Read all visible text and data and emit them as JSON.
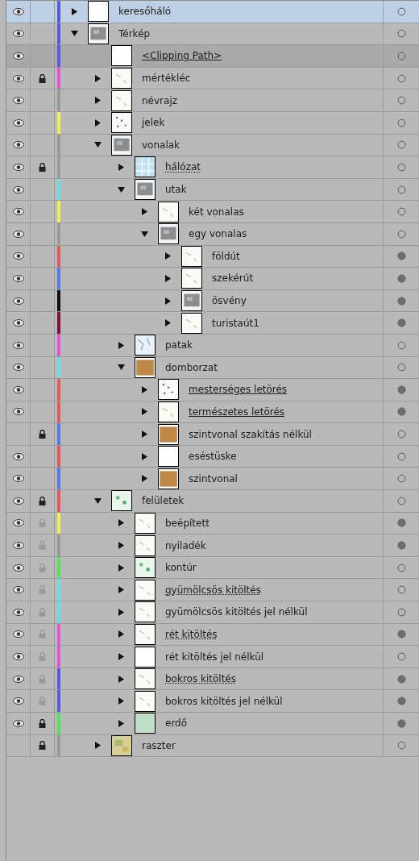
{
  "layers": [
    {
      "kind": "layer",
      "name": "keresőháló",
      "selected": true,
      "visible": true,
      "locked": false,
      "lock_greyed": false,
      "color": "#5a5ae0",
      "thumbnail": {
        "kind": "blank"
      },
      "expanded": false,
      "underlined": false,
      "dotted_underline": false,
      "target_filled": false
    },
    {
      "kind": "layer",
      "name": "Térkép",
      "selected": false,
      "visible": true,
      "locked": false,
      "lock_greyed": false,
      "color": "#5a5ae0",
      "thumbnail": {
        "kind": "texture"
      },
      "expanded": true,
      "underlined": false,
      "dotted_underline": false,
      "target_filled": false,
      "children": [
        {
          "kind": "clipping",
          "name": "<Clipping Path>",
          "selected": false,
          "visible": true,
          "locked": false,
          "lock_greyed": false,
          "color": "#5a5ae0",
          "thumbnail": {
            "kind": "blank"
          },
          "underlined": true,
          "dotted_underline": false,
          "target_filled": false
        },
        {
          "kind": "layer",
          "name": "mértékléc",
          "selected": false,
          "visible": true,
          "locked": true,
          "lock_greyed": false,
          "color": "#e055d5",
          "thumbnail": {
            "kind": "sparse"
          },
          "expanded": false,
          "underlined": false,
          "dotted_underline": false,
          "target_filled": false
        },
        {
          "kind": "layer",
          "name": "névrajz",
          "selected": false,
          "visible": true,
          "locked": false,
          "lock_greyed": false,
          "color": "#9a9a9a",
          "thumbnail": {
            "kind": "sparse"
          },
          "expanded": false,
          "underlined": false,
          "dotted_underline": false,
          "target_filled": false
        },
        {
          "kind": "layer",
          "name": "jelek",
          "selected": false,
          "visible": true,
          "locked": false,
          "lock_greyed": false,
          "color": "#f0f055",
          "thumbnail": {
            "kind": "dots"
          },
          "expanded": false,
          "underlined": false,
          "dotted_underline": false,
          "target_filled": false
        },
        {
          "kind": "layer",
          "name": "vonalak",
          "selected": false,
          "visible": true,
          "locked": false,
          "lock_greyed": false,
          "color": "#9a9a9a",
          "thumbnail": {
            "kind": "texture"
          },
          "expanded": true,
          "underlined": false,
          "dotted_underline": false,
          "target_filled": false,
          "children": [
            {
              "kind": "layer",
              "name": "hálózat",
              "selected": false,
              "visible": true,
              "locked": true,
              "lock_greyed": false,
              "color": "#9a9a9a",
              "thumbnail": {
                "kind": "grid"
              },
              "expanded": false,
              "underlined": false,
              "dotted_underline": true,
              "target_filled": false
            },
            {
              "kind": "layer",
              "name": "utak",
              "selected": false,
              "visible": true,
              "locked": false,
              "lock_greyed": false,
              "color": "#66e0e0",
              "thumbnail": {
                "kind": "texture"
              },
              "expanded": true,
              "underlined": false,
              "dotted_underline": false,
              "target_filled": false,
              "children": [
                {
                  "kind": "layer",
                  "name": "két vonalas",
                  "selected": false,
                  "visible": true,
                  "locked": false,
                  "lock_greyed": false,
                  "color": "#f0f055",
                  "thumbnail": {
                    "kind": "sparse"
                  },
                  "expanded": false,
                  "underlined": false,
                  "dotted_underline": false,
                  "target_filled": false
                },
                {
                  "kind": "layer",
                  "name": "egy vonalas",
                  "selected": false,
                  "visible": true,
                  "locked": false,
                  "lock_greyed": false,
                  "color": "#9a9a9a",
                  "thumbnail": {
                    "kind": "texture"
                  },
                  "expanded": true,
                  "underlined": false,
                  "dotted_underline": false,
                  "target_filled": false,
                  "children": [
                    {
                      "kind": "layer",
                      "name": "földút",
                      "selected": false,
                      "visible": true,
                      "locked": false,
                      "lock_greyed": false,
                      "color": "#e05a5a",
                      "thumbnail": {
                        "kind": "sparse"
                      },
                      "expanded": false,
                      "underlined": false,
                      "dotted_underline": false,
                      "target_filled": true
                    },
                    {
                      "kind": "layer",
                      "name": "szekérút",
                      "selected": false,
                      "visible": true,
                      "locked": false,
                      "lock_greyed": false,
                      "color": "#5a7ae0",
                      "thumbnail": {
                        "kind": "sparse"
                      },
                      "expanded": false,
                      "underlined": false,
                      "dotted_underline": false,
                      "target_filled": true
                    },
                    {
                      "kind": "layer",
                      "name": "ösvény",
                      "selected": false,
                      "visible": true,
                      "locked": false,
                      "lock_greyed": false,
                      "color": "#111111",
                      "thumbnail": {
                        "kind": "texture"
                      },
                      "expanded": false,
                      "underlined": false,
                      "dotted_underline": false,
                      "target_filled": true
                    },
                    {
                      "kind": "layer",
                      "name": "turistaút1",
                      "selected": false,
                      "visible": true,
                      "locked": false,
                      "lock_greyed": false,
                      "color": "#801040",
                      "thumbnail": {
                        "kind": "sparse"
                      },
                      "expanded": false,
                      "underlined": false,
                      "dotted_underline": false,
                      "target_filled": true
                    }
                  ]
                }
              ]
            },
            {
              "kind": "layer",
              "name": "patak",
              "selected": false,
              "visible": true,
              "locked": false,
              "lock_greyed": false,
              "color": "#e055d5",
              "thumbnail": {
                "kind": "water"
              },
              "expanded": false,
              "underlined": false,
              "dotted_underline": false,
              "target_filled": false
            },
            {
              "kind": "layer",
              "name": "domborzat",
              "selected": false,
              "visible": true,
              "locked": false,
              "lock_greyed": false,
              "color": "#66e0e0",
              "thumbnail": {
                "kind": "brown"
              },
              "expanded": true,
              "underlined": false,
              "dotted_underline": false,
              "target_filled": false,
              "children": [
                {
                  "kind": "layer",
                  "name": "mesterséges letörés",
                  "selected": false,
                  "visible": true,
                  "locked": false,
                  "lock_greyed": false,
                  "color": "#e05a5a",
                  "thumbnail": {
                    "kind": "dots"
                  },
                  "expanded": false,
                  "underlined": true,
                  "dotted_underline": false,
                  "target_filled": true
                },
                {
                  "kind": "layer",
                  "name": "természetes letörés",
                  "selected": false,
                  "visible": true,
                  "locked": false,
                  "lock_greyed": false,
                  "color": "#e05a5a",
                  "thumbnail": {
                    "kind": "sparse"
                  },
                  "expanded": false,
                  "underlined": true,
                  "dotted_underline": false,
                  "target_filled": true
                },
                {
                  "kind": "layer",
                  "name": "szintvonal szakítás nélkül",
                  "selected": false,
                  "visible": false,
                  "locked": true,
                  "lock_greyed": false,
                  "color": "#5a7ae0",
                  "thumbnail": {
                    "kind": "brown"
                  },
                  "expanded": false,
                  "underlined": false,
                  "dotted_underline": false,
                  "target_filled": false
                },
                {
                  "kind": "layer",
                  "name": "eséstüske",
                  "selected": false,
                  "visible": true,
                  "locked": false,
                  "lock_greyed": false,
                  "color": "#e05a5a",
                  "thumbnail": {
                    "kind": "blank"
                  },
                  "expanded": false,
                  "underlined": false,
                  "dotted_underline": false,
                  "target_filled": false
                },
                {
                  "kind": "layer",
                  "name": "szintvonal",
                  "selected": false,
                  "visible": true,
                  "locked": false,
                  "lock_greyed": false,
                  "color": "#5a7ae0",
                  "thumbnail": {
                    "kind": "brown"
                  },
                  "expanded": false,
                  "underlined": false,
                  "dotted_underline": false,
                  "target_filled": false
                }
              ]
            }
          ]
        },
        {
          "kind": "layer",
          "name": "felületek",
          "selected": false,
          "visible": true,
          "locked": true,
          "lock_greyed": false,
          "color": "#e05a5a",
          "thumbnail": {
            "kind": "green"
          },
          "expanded": true,
          "underlined": false,
          "dotted_underline": false,
          "target_filled": false,
          "children": [
            {
              "kind": "layer",
              "name": "beépített",
              "selected": false,
              "visible": true,
              "locked": false,
              "lock_greyed": true,
              "color": "#f0f055",
              "thumbnail": {
                "kind": "sparse"
              },
              "expanded": false,
              "underlined": false,
              "dotted_underline": false,
              "target_filled": true
            },
            {
              "kind": "layer",
              "name": "nyiladék",
              "selected": false,
              "visible": true,
              "locked": false,
              "lock_greyed": true,
              "color": "#9a9a9a",
              "thumbnail": {
                "kind": "sparse"
              },
              "expanded": false,
              "underlined": false,
              "dotted_underline": false,
              "target_filled": true
            },
            {
              "kind": "layer",
              "name": "kontúr",
              "selected": false,
              "visible": true,
              "locked": false,
              "lock_greyed": true,
              "color": "#5ae05a",
              "thumbnail": {
                "kind": "green"
              },
              "expanded": false,
              "underlined": false,
              "dotted_underline": false,
              "target_filled": false
            },
            {
              "kind": "layer",
              "name": "gyümölcsös kitöltés",
              "selected": false,
              "visible": true,
              "locked": false,
              "lock_greyed": true,
              "color": "#66e0e0",
              "thumbnail": {
                "kind": "sparse"
              },
              "expanded": false,
              "underlined": false,
              "dotted_underline": true,
              "target_filled": false
            },
            {
              "kind": "layer",
              "name": "gyümölcsös kitöltés jel nélkül",
              "selected": false,
              "visible": true,
              "locked": false,
              "lock_greyed": true,
              "color": "#66e0e0",
              "thumbnail": {
                "kind": "sparse"
              },
              "expanded": false,
              "underlined": false,
              "dotted_underline": false,
              "target_filled": false
            },
            {
              "kind": "layer",
              "name": "rét kitöltés",
              "selected": false,
              "visible": true,
              "locked": false,
              "lock_greyed": true,
              "color": "#e055d5",
              "thumbnail": {
                "kind": "sparse"
              },
              "expanded": false,
              "underlined": false,
              "dotted_underline": true,
              "target_filled": true
            },
            {
              "kind": "layer",
              "name": "rét kitöltés jel nélkül",
              "selected": false,
              "visible": true,
              "locked": false,
              "lock_greyed": true,
              "color": "#e055d5",
              "thumbnail": {
                "kind": "blank"
              },
              "expanded": false,
              "underlined": false,
              "dotted_underline": false,
              "target_filled": false
            },
            {
              "kind": "layer",
              "name": "bokros kitöltés",
              "selected": false,
              "visible": true,
              "locked": false,
              "lock_greyed": true,
              "color": "#5a5ae0",
              "thumbnail": {
                "kind": "sparse"
              },
              "expanded": false,
              "underlined": false,
              "dotted_underline": true,
              "target_filled": true
            },
            {
              "kind": "layer",
              "name": "bokros kitöltés jel nélkül",
              "selected": false,
              "visible": true,
              "locked": false,
              "lock_greyed": true,
              "color": "#5a5ae0",
              "thumbnail": {
                "kind": "sparse"
              },
              "expanded": false,
              "underlined": false,
              "dotted_underline": false,
              "target_filled": true
            },
            {
              "kind": "layer",
              "name": "erdő",
              "selected": false,
              "visible": true,
              "locked": true,
              "lock_greyed": false,
              "color": "#5ae05a",
              "thumbnail": {
                "kind": "mint"
              },
              "expanded": false,
              "underlined": false,
              "dotted_underline": false,
              "target_filled": true
            }
          ]
        },
        {
          "kind": "layer",
          "name": "raszter",
          "selected": false,
          "visible": false,
          "locked": true,
          "lock_greyed": false,
          "color": "#9a9a9a",
          "thumbnail": {
            "kind": "map"
          },
          "expanded": false,
          "underlined": false,
          "dotted_underline": false,
          "target_filled": false
        }
      ]
    }
  ]
}
